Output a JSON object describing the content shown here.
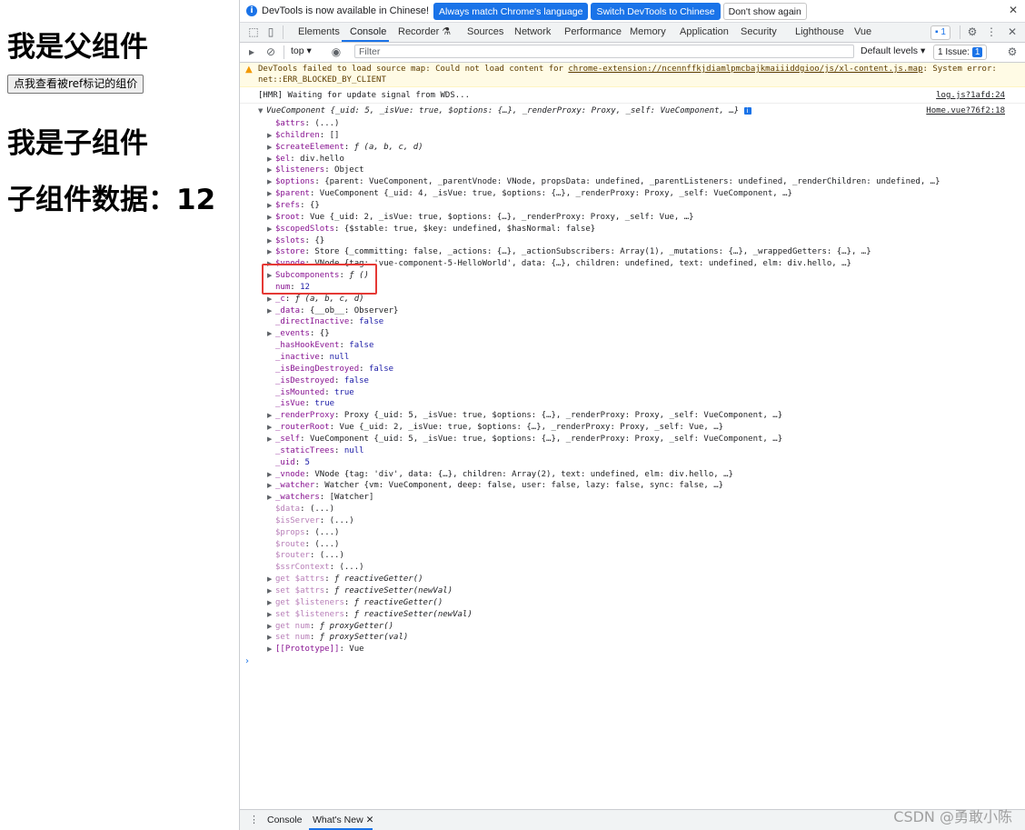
{
  "page": {
    "parent_title": "我是父组件",
    "ref_button_label": "点我查看被ref标记的组价",
    "child_title": "我是子组件",
    "child_data_label": "子组件数据：12"
  },
  "infobar": {
    "icon": "info-icon",
    "text": "DevTools is now available in Chinese!",
    "btn_match": "Always match Chrome's language",
    "btn_switch": "Switch DevTools to Chinese",
    "btn_dont_show": "Don't show again",
    "close": "✕"
  },
  "tabs": {
    "items": [
      "Elements",
      "Console",
      "Recorder ⚗",
      "Sources",
      "Network",
      "Performance",
      "Memory",
      "Application",
      "Security",
      "Lighthouse",
      "Vue"
    ],
    "active": "Console",
    "messages_count": "1"
  },
  "console_toolbar": {
    "context": "top ▾",
    "filter_placeholder": "Filter",
    "levels": "Default levels ▾",
    "issues_label": "1 Issue:",
    "issues_count": "1"
  },
  "warning": {
    "line1_prefix": "DevTools failed to load source map: Could not load content for ",
    "line1_link": "chrome-extension://ncennffkjdiamlpmcbajkmaiiiddgioo/js/xl-content.js.map",
    "line1_suffix": ": System error:",
    "line2": "net::ERR_BLOCKED_BY_CLIENT"
  },
  "hmr": {
    "text": "[HMR] Waiting for update signal from WDS...",
    "source": "log.js?1afd:24"
  },
  "vue_component": {
    "header": "VueComponent {_uid: 5, _isVue: true, $options: {…}, _renderProxy: Proxy, _self: VueComponent, …}",
    "source": "Home.vue?76f2:18",
    "props": [
      {
        "key": "$attrs",
        "value": "(...)",
        "expand": false
      },
      {
        "key": "$children",
        "value": "[]",
        "expand": true
      },
      {
        "key": "$createElement",
        "value": "ƒ (a, b, c, d)",
        "expand": true
      },
      {
        "key": "$el",
        "value": "div.hello",
        "expand": true
      },
      {
        "key": "$listeners",
        "value": "Object",
        "expand": true
      },
      {
        "key": "$options",
        "value": "{parent: VueComponent, _parentVnode: VNode, propsData: undefined, _parentListeners: undefined, _renderChildren: undefined, …}",
        "expand": true
      },
      {
        "key": "$parent",
        "value": "VueComponent {_uid: 4, _isVue: true, $options: {…}, _renderProxy: Proxy, _self: VueComponent, …}",
        "expand": true
      },
      {
        "key": "$refs",
        "value": "{}",
        "expand": true
      },
      {
        "key": "$root",
        "value": "Vue {_uid: 2, _isVue: true, $options: {…}, _renderProxy: Proxy, _self: Vue, …}",
        "expand": true
      },
      {
        "key": "$scopedSlots",
        "value": "{$stable: true, $key: undefined, $hasNormal: false}",
        "expand": true
      },
      {
        "key": "$slots",
        "value": "{}",
        "expand": true
      },
      {
        "key": "$store",
        "value": "Store {_committing: false, _actions: {…}, _actionSubscribers: Array(1), _mutations: {…}, _wrappedGetters: {…}, …}",
        "expand": true
      },
      {
        "key": "$vnode",
        "value": "VNode {tag: 'vue-component-5-HelloWorld', data: {…}, children: undefined, text: undefined, elm: div.hello, …}",
        "expand": true
      },
      {
        "key": "Subcomponents",
        "value": "ƒ ()",
        "expand": true
      },
      {
        "key": "num",
        "value": "12",
        "expand": false
      },
      {
        "key": "_c",
        "value": "ƒ (a, b, c, d)",
        "expand": true
      },
      {
        "key": "_data",
        "value": "{__ob__: Observer}",
        "expand": true
      },
      {
        "key": "_directInactive",
        "value": "false",
        "expand": false
      },
      {
        "key": "_events",
        "value": "{}",
        "expand": true
      },
      {
        "key": "_hasHookEvent",
        "value": "false",
        "expand": false
      },
      {
        "key": "_inactive",
        "value": "null",
        "expand": false
      },
      {
        "key": "_isBeingDestroyed",
        "value": "false",
        "expand": false
      },
      {
        "key": "_isDestroyed",
        "value": "false",
        "expand": false
      },
      {
        "key": "_isMounted",
        "value": "true",
        "expand": false
      },
      {
        "key": "_isVue",
        "value": "true",
        "expand": false
      },
      {
        "key": "_renderProxy",
        "value": "Proxy {_uid: 5, _isVue: true, $options: {…}, _renderProxy: Proxy, _self: VueComponent, …}",
        "expand": true
      },
      {
        "key": "_routerRoot",
        "value": "Vue {_uid: 2, _isVue: true, $options: {…}, _renderProxy: Proxy, _self: Vue, …}",
        "expand": true
      },
      {
        "key": "_self",
        "value": "VueComponent {_uid: 5, _isVue: true, $options: {…}, _renderProxy: Proxy, _self: VueComponent, …}",
        "expand": true
      },
      {
        "key": "_staticTrees",
        "value": "null",
        "expand": false
      },
      {
        "key": "_uid",
        "value": "5",
        "expand": false
      },
      {
        "key": "_vnode",
        "value": "VNode {tag: 'div', data: {…}, children: Array(2), text: undefined, elm: div.hello, …}",
        "expand": true
      },
      {
        "key": "_watcher",
        "value": "Watcher {vm: VueComponent, deep: false, user: false, lazy: false, sync: false, …}",
        "expand": true
      },
      {
        "key": "_watchers",
        "value": "[Watcher]",
        "expand": true
      },
      {
        "key": "$data",
        "value": "(...)",
        "expand": false,
        "faded": true
      },
      {
        "key": "$isServer",
        "value": "(...)",
        "expand": false,
        "faded": true
      },
      {
        "key": "$props",
        "value": "(...)",
        "expand": false,
        "faded": true
      },
      {
        "key": "$route",
        "value": "(...)",
        "expand": false,
        "faded": true
      },
      {
        "key": "$router",
        "value": "(...)",
        "expand": false,
        "faded": true
      },
      {
        "key": "$ssrContext",
        "value": "(...)",
        "expand": false,
        "faded": true
      },
      {
        "key": "get $attrs",
        "value": "ƒ reactiveGetter()",
        "expand": true,
        "faded": true
      },
      {
        "key": "set $attrs",
        "value": "ƒ reactiveSetter(newVal)",
        "expand": true,
        "faded": true
      },
      {
        "key": "get $listeners",
        "value": "ƒ reactiveGetter()",
        "expand": true,
        "faded": true
      },
      {
        "key": "set $listeners",
        "value": "ƒ reactiveSetter(newVal)",
        "expand": true,
        "faded": true
      },
      {
        "key": "get num",
        "value": "ƒ proxyGetter()",
        "expand": true,
        "faded": true
      },
      {
        "key": "set num",
        "value": "ƒ proxySetter(val)",
        "expand": true,
        "faded": true
      },
      {
        "key": "[[Prototype]]",
        "value": "Vue",
        "expand": true
      }
    ]
  },
  "drawer": {
    "menu": "⋮",
    "tab_console": "Console",
    "tab_whats_new": "What's New",
    "close": "✕"
  },
  "watermark": "CSDN @勇敢小陈"
}
